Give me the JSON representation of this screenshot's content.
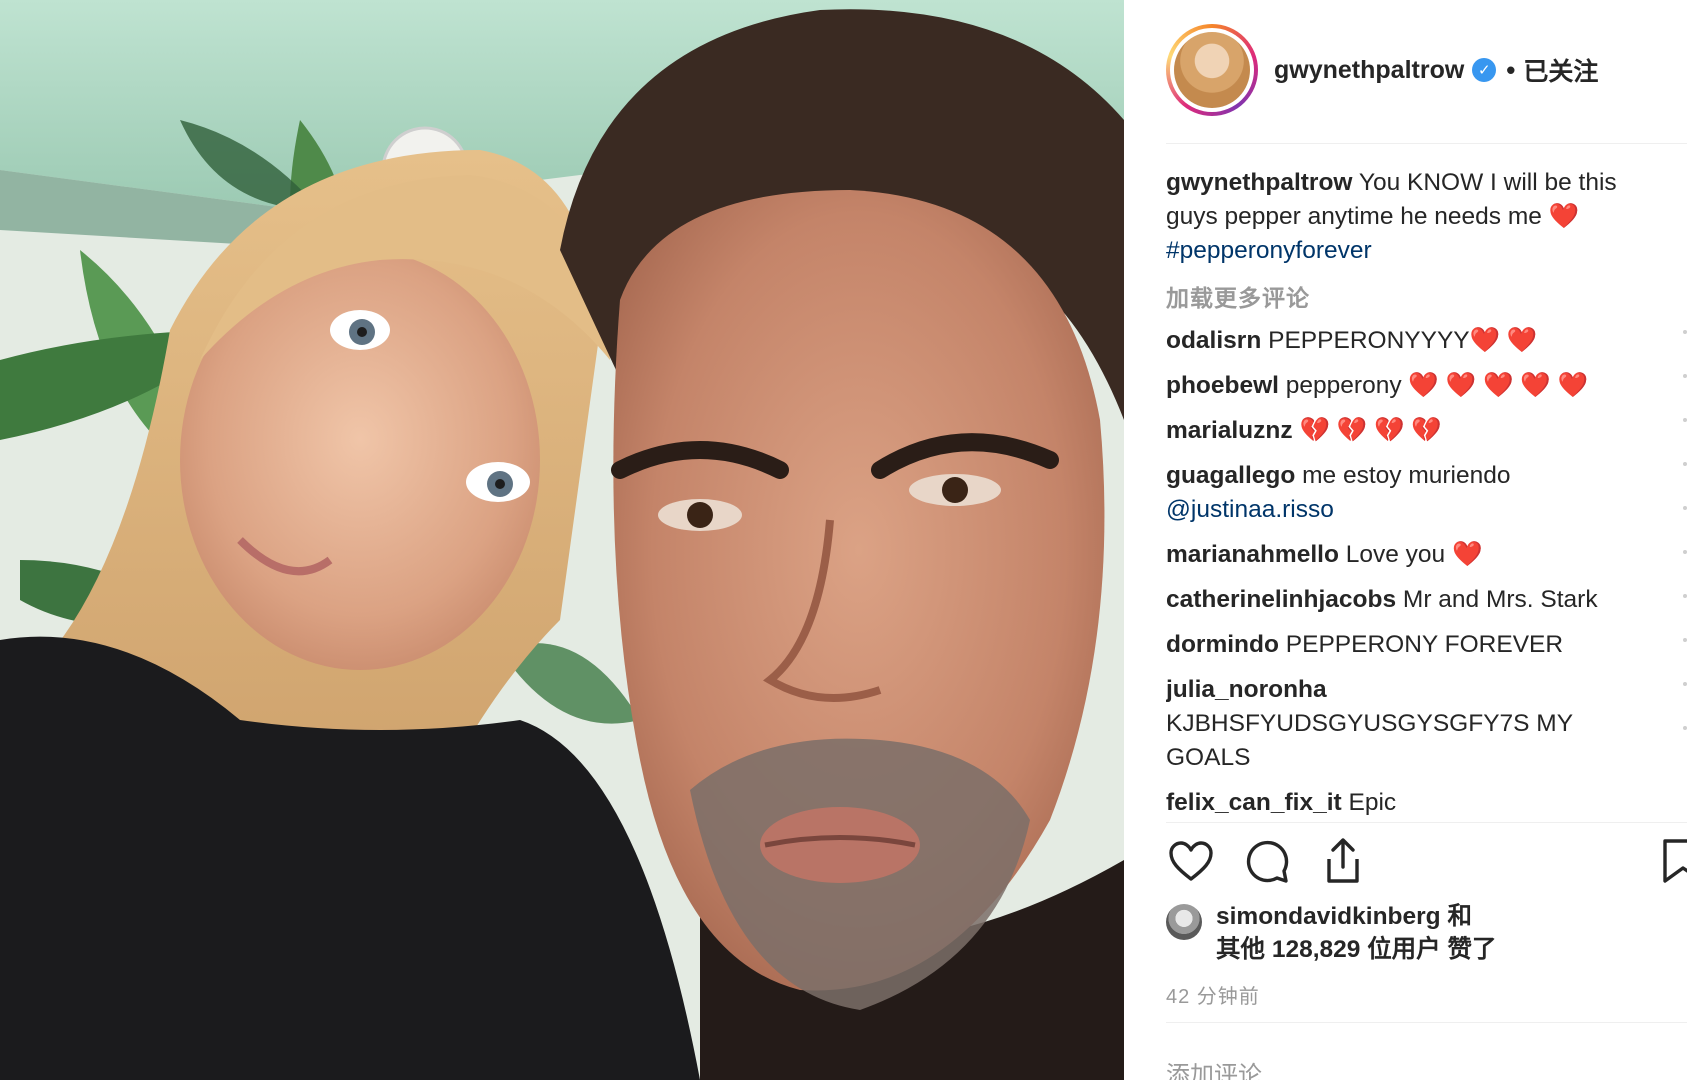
{
  "post": {
    "author": "gwynethpaltrow",
    "follow_status": "已关注",
    "separator": "•",
    "verified_mark": "✓"
  },
  "caption": {
    "username": "gwynethpaltrow",
    "text": "You KNOW I will be this guys pepper anytime he needs me ❤️",
    "hashtag": "#pepperonyforever"
  },
  "load_more": "加载更多评论",
  "comments": [
    {
      "user": "odalisrn",
      "text": "PEPPERONYYYY❤️ ❤️"
    },
    {
      "user": "phoebewl",
      "text": "pepperony ❤️ ❤️ ❤️ ❤️ ❤️"
    },
    {
      "user": "marialuznz",
      "text": "💔 💔 💔 💔"
    },
    {
      "user": "guagallego",
      "text": "me estoy muriendo",
      "mention": "@justinaa.risso"
    },
    {
      "user": "marianahmello",
      "text": "Love you ❤️"
    },
    {
      "user": "catherinelinhjacobs",
      "text": "Mr and Mrs. Stark"
    },
    {
      "user": "dormindo",
      "text": "PEPPERONY FOREVER"
    },
    {
      "user": "julia_noronha",
      "text": "KJBHSFYUDSGYUSGYSGFY7S MY GOALS"
    },
    {
      "user": "felix_can_fix_it",
      "text": "Epic"
    }
  ],
  "likes": {
    "first_user": "simondavidkinberg",
    "joiner": "和",
    "others_prefix": "其他",
    "count": "128,829",
    "others_suffix": "位用户 赞了"
  },
  "timestamp": "42 分钟前",
  "add_comment_placeholder": "添加评论……",
  "icons": [
    "heart-icon",
    "comment-icon",
    "share-icon",
    "bookmark-icon",
    "verified-badge-icon"
  ],
  "colors": {
    "link": "#003569",
    "muted": "#999999",
    "verified": "#3897f0",
    "text": "#262626"
  }
}
